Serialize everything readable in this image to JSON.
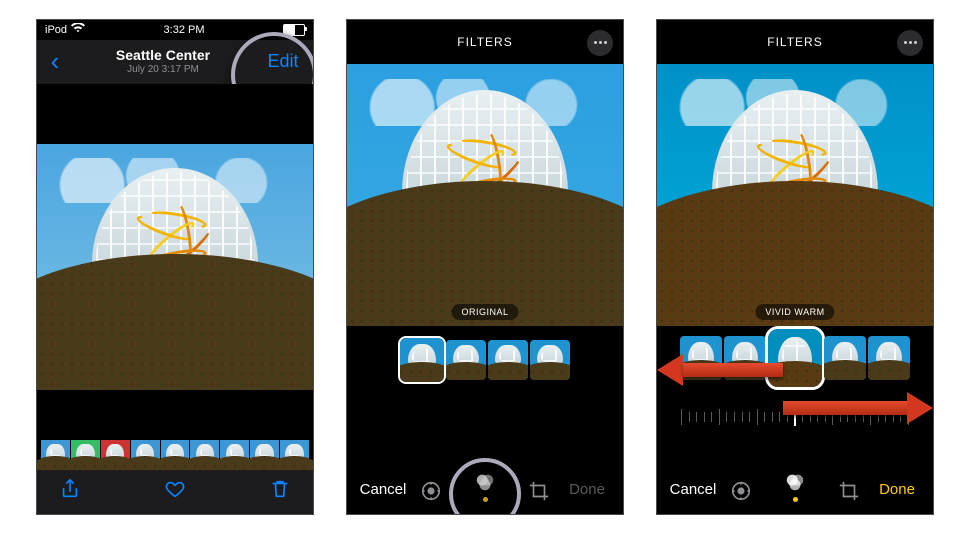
{
  "status": {
    "device": "iPod",
    "wifi_icon": "wifi",
    "time": "3:32 PM",
    "battery_pct": 55
  },
  "screen1": {
    "back_icon": "chevron-left",
    "title": "Seattle Center",
    "subtitle": "July 20  3:17 PM",
    "edit_label": "Edit",
    "share_icon": "share",
    "favorite_icon": "heart",
    "trash_icon": "trash",
    "filmstrip_count": 9
  },
  "screen2": {
    "header": "FILTERS",
    "more_icon": "ellipsis",
    "filter_name": "ORIGINAL",
    "thumb_count": 4,
    "selected_index": 0,
    "cancel": "Cancel",
    "done": "Done",
    "done_enabled": false,
    "modes": {
      "adjust": "adjust-icon",
      "filters": "filters-icon",
      "crop": "crop-icon",
      "selected": "filters"
    }
  },
  "screen3": {
    "header": "FILTERS",
    "more_icon": "ellipsis",
    "filter_name": "VIVID WARM",
    "thumb_count": 5,
    "selected_index": 2,
    "slider_value": 50,
    "cancel": "Cancel",
    "done": "Done",
    "done_enabled": true,
    "modes": {
      "adjust": "adjust-icon",
      "filters": "filters-icon",
      "crop": "crop-icon",
      "selected": "filters"
    },
    "annotation": "swipe-left-right-arrows"
  },
  "colors": {
    "ios_blue": "#0a84ff",
    "ios_yellow": "#ffcc00",
    "arrow_red": "#d3381e"
  }
}
